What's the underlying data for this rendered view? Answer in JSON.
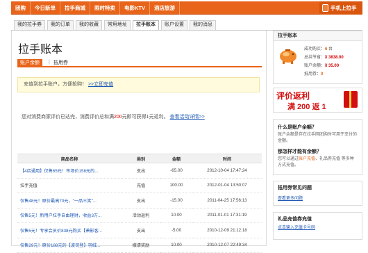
{
  "topnav": {
    "items": [
      "团购",
      "今日新单",
      "拉手商城",
      "限时特卖",
      "电影KTV",
      "酒店旅游"
    ],
    "mobile": "手机上拉手"
  },
  "tabs": [
    "我的拉手券",
    "我的订单",
    "我的收藏",
    "常用地址",
    "拉手账本",
    "账户设置",
    "我的消息"
  ],
  "page": {
    "title": "拉手账本",
    "subtab_active": "账户余额",
    "subtab_sep": "|",
    "subtab_other": "抵用券"
  },
  "notice": {
    "text": "充值到拉手账户，方便抢购！",
    "link": ">>立即充值"
  },
  "eval": {
    "pre": "您对消费商家评价已达完，消费评价总和满",
    "amount": "200",
    "post": "元即可获得1元返利。",
    "link": "查看活动详情>>"
  },
  "table": {
    "headers": [
      "商品名称",
      "类别",
      "金额",
      "时间"
    ],
    "rows": [
      {
        "name": "【4店通用】仅售65元！市场价158元的...",
        "type": "支出",
        "amount": "-65.00",
        "time": "2012-10-04 17:47:24"
      },
      {
        "name": "拉手充值",
        "type": "充值",
        "amount": "100.00",
        "time": "2012-01-04 13:50:07"
      },
      {
        "name": "仅售48元！原价最高70元，\"一品三笑\"...",
        "type": "支出",
        "amount": "-15.00",
        "time": "2011-04-25 17:56:13"
      },
      {
        "name": "仅售5元！新用户拉手自由理财，收益3万...",
        "type": "活动返利",
        "amount": "10.00",
        "time": "2011-01-01 17:31:19"
      },
      {
        "name": "仅售5元！专享会员价838元购买【萧影客...",
        "type": "支出",
        "amount": "-5.00",
        "time": "2010-12-09 21:12:18"
      },
      {
        "name": "仅售29元！原价188元的【波司登】羽绒...",
        "type": "撤请奖励",
        "amount": "10.00",
        "time": "2010-12-07 22:49:34"
      }
    ]
  },
  "sidebar": {
    "account": {
      "title": "拉手账本",
      "buy_label": "成功购买：",
      "buy_count": "6",
      "buy_unit": "台",
      "save_label": "总共节省：",
      "save_value": "¥ 3838.00",
      "balance_label": "账户余额：",
      "balance_value": "¥ 35.00",
      "coupon_label": "抵用券：",
      "coupon_value": "0"
    },
    "banner": {
      "line1": "评价返利",
      "line2": "满 200 返 1"
    },
    "faq": {
      "q1": "什么是账户余额？",
      "a1_pre": "账户余额是存在拉手网团购时可用于支付的金额。",
      "q2": "那怎样才能有余额？",
      "a2_pre": "您可以通过",
      "a2_link1": "账户充值",
      "a2_mid": "、礼品券充值 等",
      "a2_post": "多种方式充值。"
    },
    "coupon_faq": {
      "title": "抵用券常见问题",
      "link": "查看更多问题"
    },
    "gift_card": {
      "title": "礼品充值券充值",
      "link": "点击输入充值卡号码"
    }
  }
}
